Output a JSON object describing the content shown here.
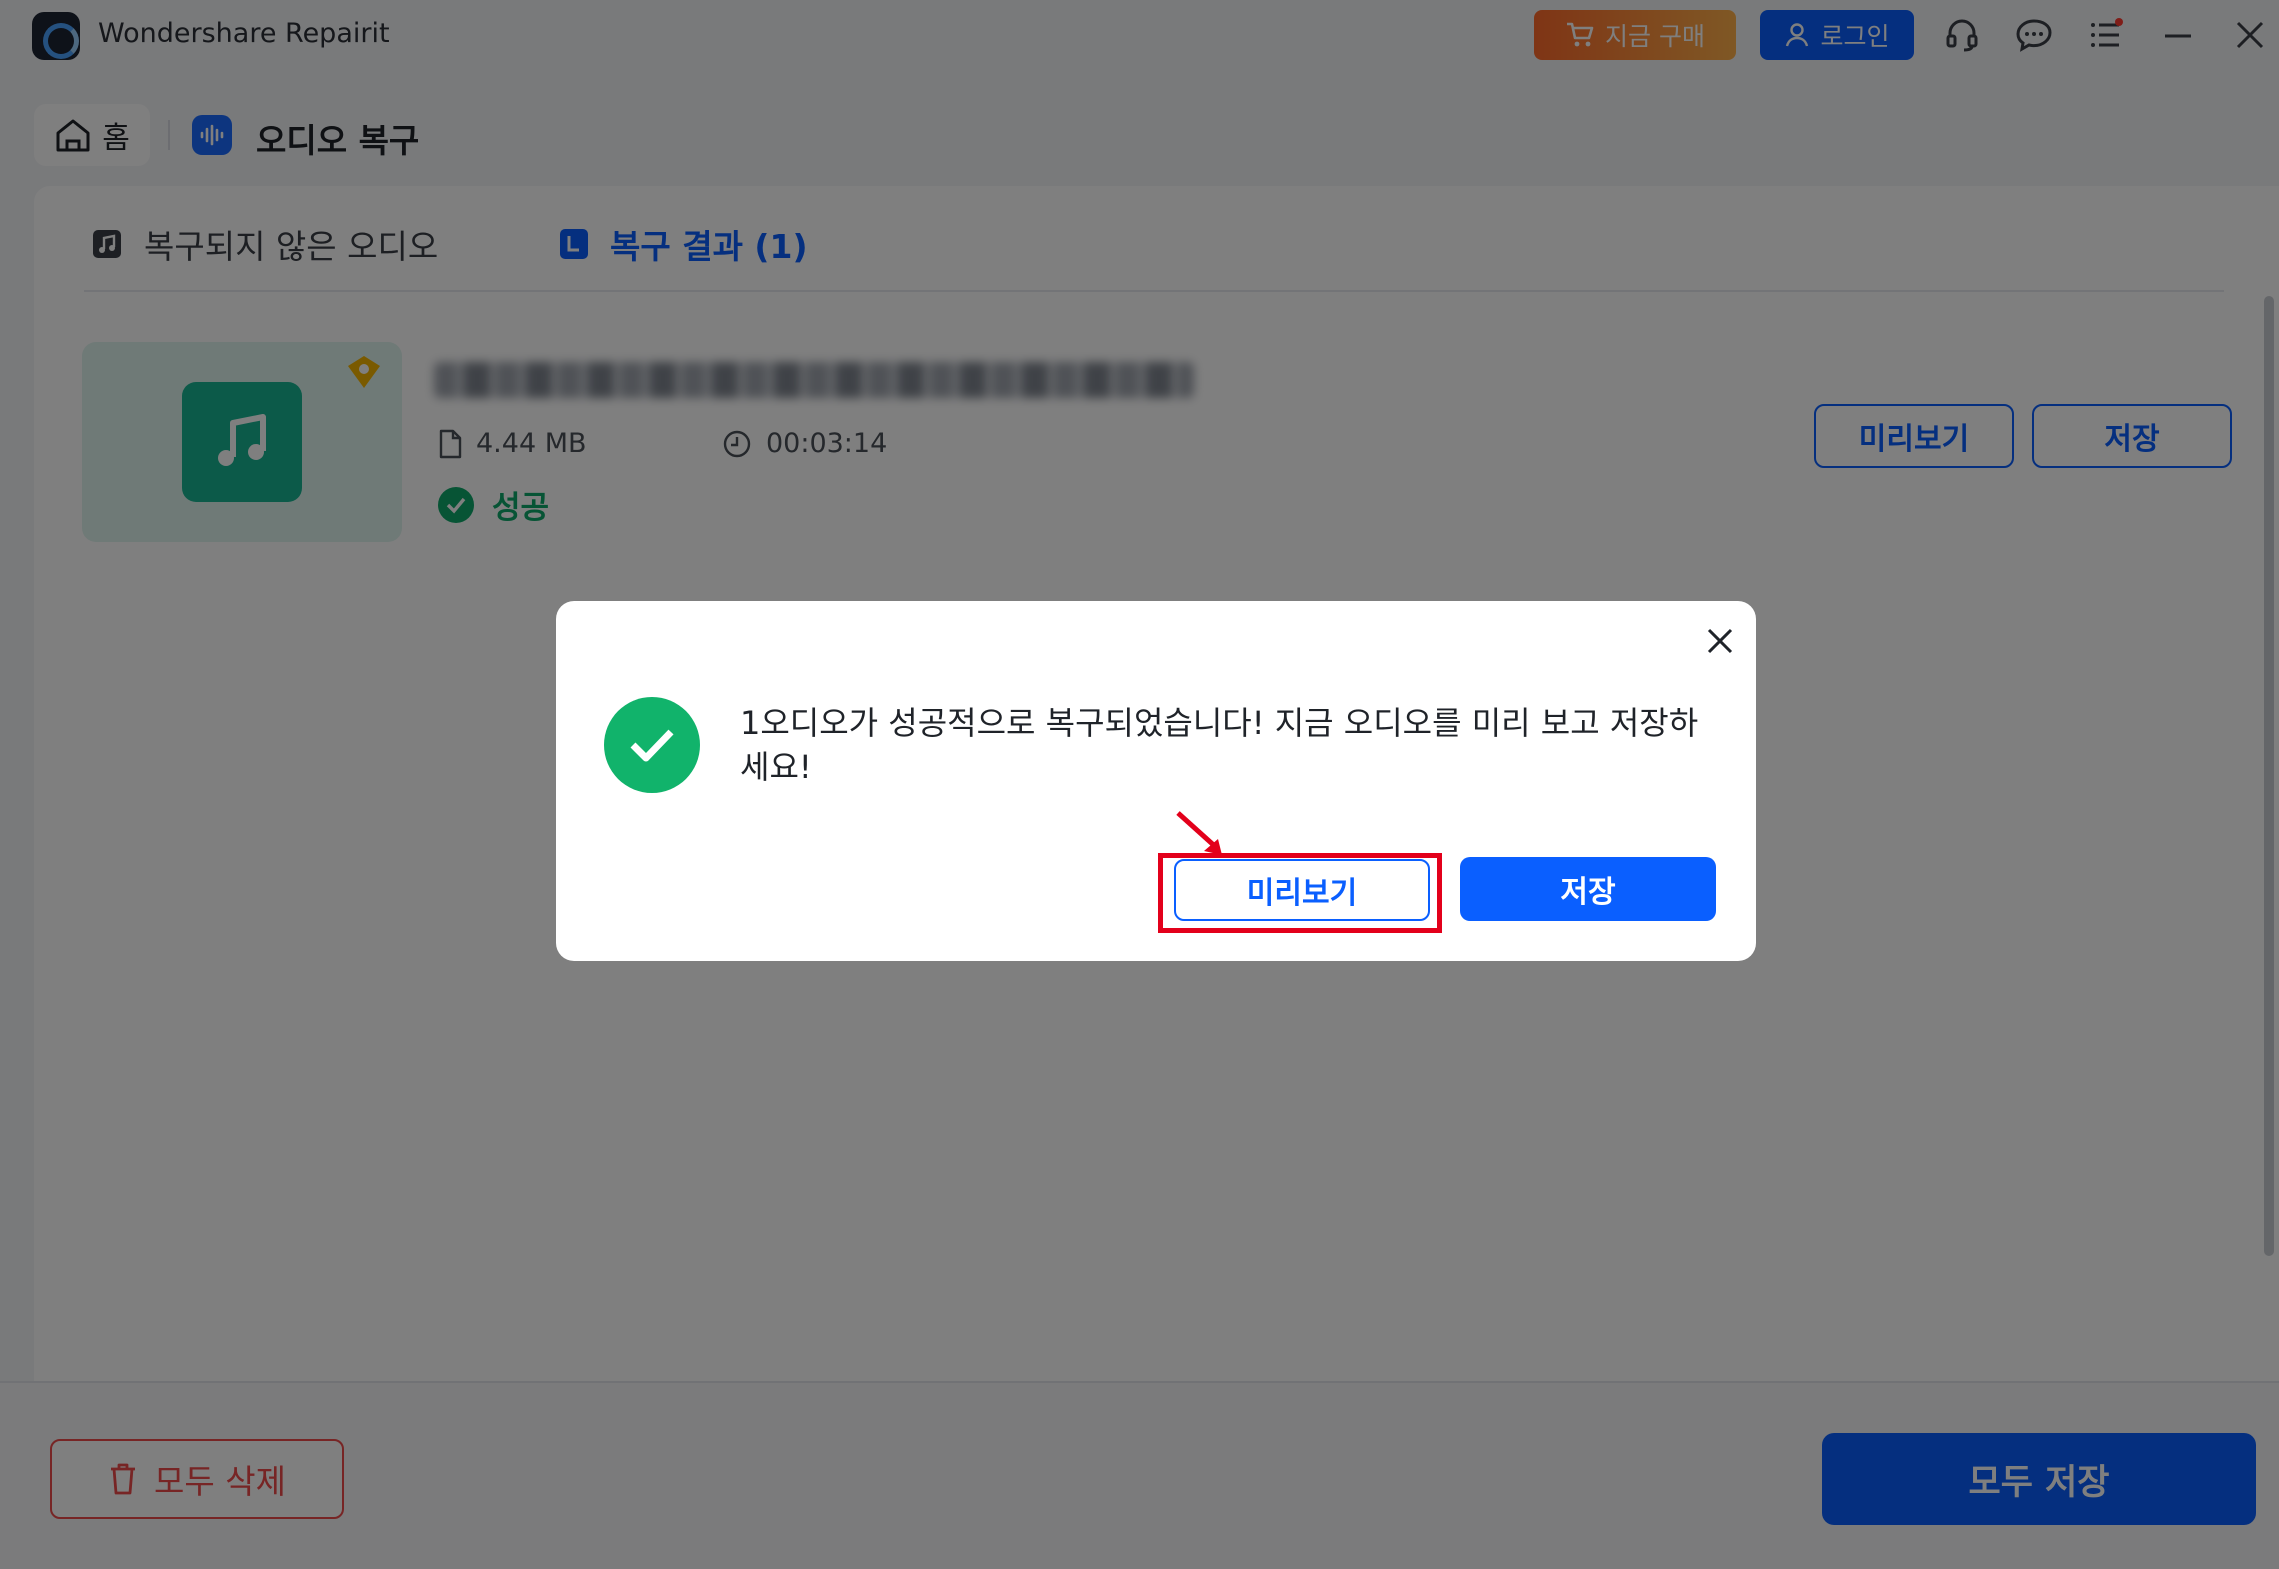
{
  "app": {
    "title": "Wondershare Repairit"
  },
  "titlebar": {
    "buy_label": "지금 구매",
    "login_label": "로그인",
    "icons": [
      "cart-icon",
      "user-icon",
      "headset-icon",
      "chat-icon",
      "menu-icon",
      "minimize-icon",
      "close-icon"
    ]
  },
  "breadcrumb": {
    "home_label": "홈",
    "current_label": "오디오 복구"
  },
  "tabs": {
    "unrecovered_label": "복구되지 않은 오디오",
    "result_label": "복구 결과 (1)"
  },
  "file": {
    "size": "4.44 MB",
    "duration": "00:03:14",
    "status": "성공",
    "preview_label": "미리보기",
    "save_label": "저장"
  },
  "footer": {
    "delete_all_label": "모두 삭제",
    "save_all_label": "모두 저장"
  },
  "dialog": {
    "message": "1오디오가 성공적으로 복구되었습니다! 지금 오디오를 미리 보고 저장하세요!",
    "preview_label": "미리보기",
    "save_label": "저장"
  },
  "colors": {
    "accent": "#0a5fff",
    "success": "#11b36b",
    "danger": "#ef4a4a",
    "highlight": "#e3001b",
    "buy_gradient_start": "#ff6a2b",
    "buy_gradient_end": "#ffb04a"
  }
}
